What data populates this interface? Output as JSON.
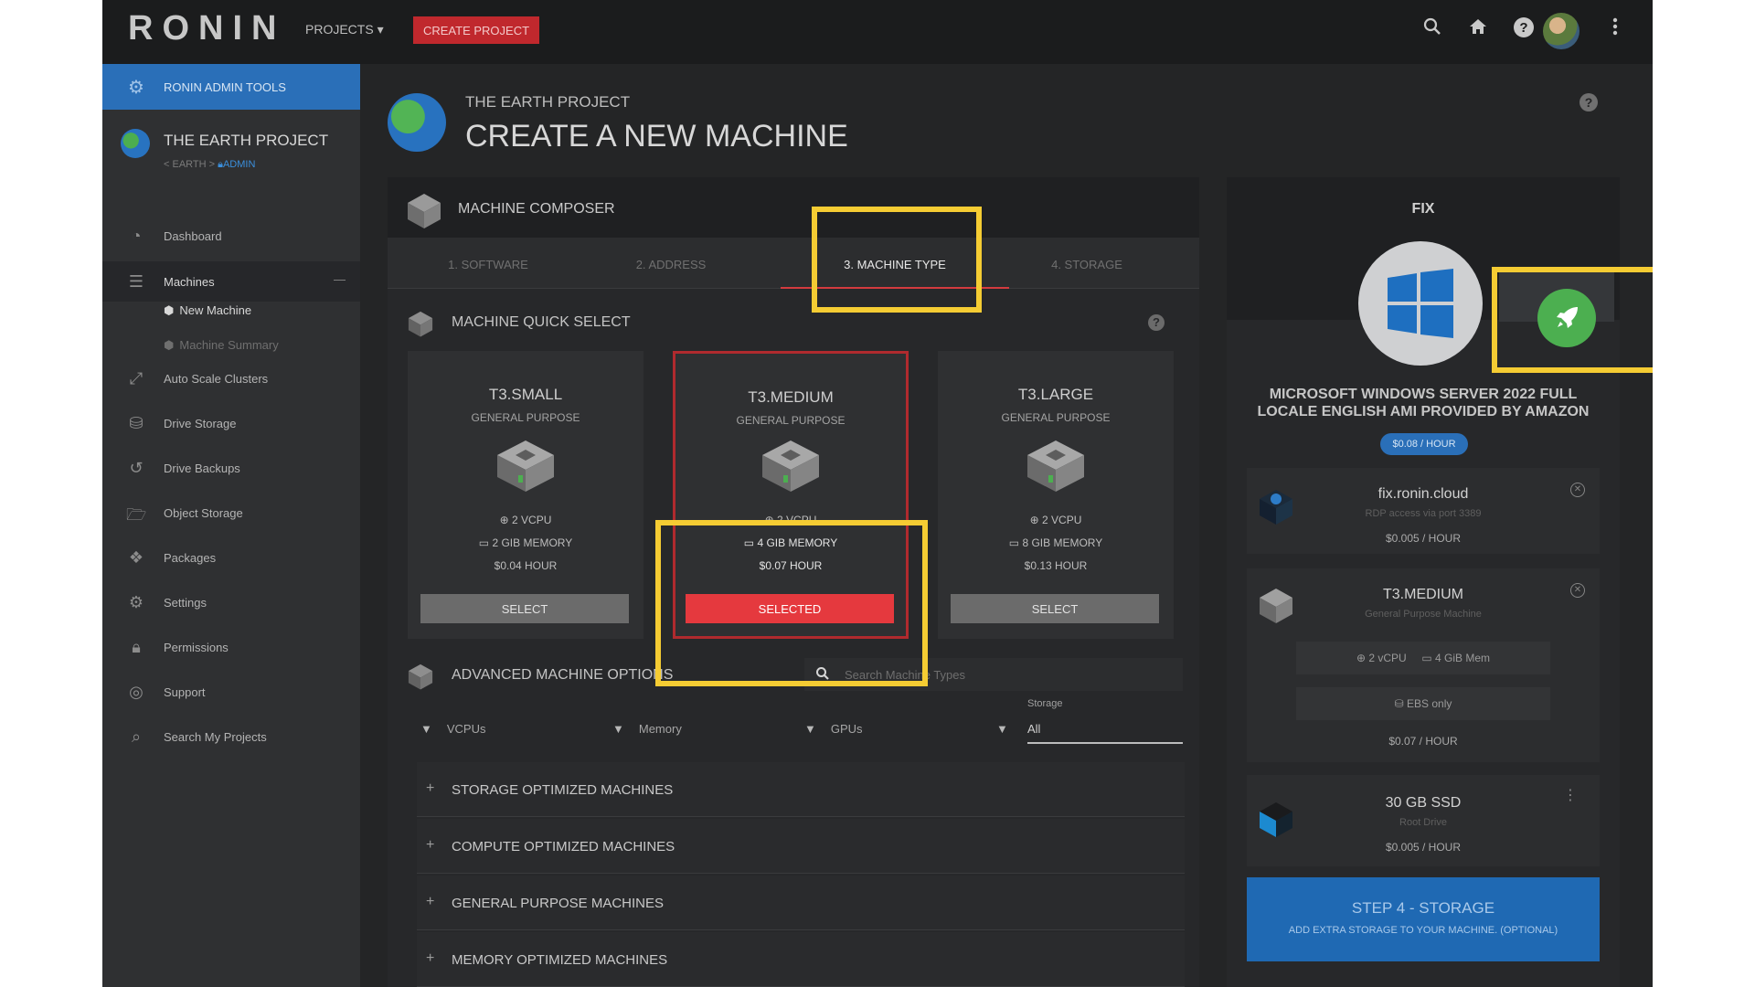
{
  "topbar": {
    "logo": "RONIN",
    "projects_label": "PROJECTS ▾",
    "create_project_label": "CREATE PROJECT",
    "icons": [
      "search-icon",
      "home-icon",
      "help-icon",
      "avatar",
      "kebab-icon"
    ]
  },
  "sidebar": {
    "admin_tools": "RONIN ADMIN TOOLS",
    "project_name": "THE EARTH PROJECT",
    "crumb": "< EARTH >",
    "crumb_admin": "ADMIN",
    "items": [
      {
        "label": "Dashboard",
        "icon": "dashboard-icon"
      },
      {
        "label": "Machines",
        "icon": "server-icon"
      },
      {
        "label": "Auto Scale Clusters",
        "icon": "expand-icon"
      },
      {
        "label": "Drive Storage",
        "icon": "drive-icon"
      },
      {
        "label": "Drive Backups",
        "icon": "history-icon"
      },
      {
        "label": "Object Storage",
        "icon": "folder-icon"
      },
      {
        "label": "Packages",
        "icon": "packages-icon"
      },
      {
        "label": "Settings",
        "icon": "gear-icon"
      },
      {
        "label": "Permissions",
        "icon": "lock-icon"
      },
      {
        "label": "Support",
        "icon": "lifebuoy-icon"
      },
      {
        "label": "Search My Projects",
        "icon": "search-icon"
      }
    ],
    "machines_collapse": "—",
    "sub_items": [
      {
        "label": "New Machine"
      },
      {
        "label": "Machine Summary"
      }
    ]
  },
  "header": {
    "subtitle": "THE EARTH PROJECT",
    "title": "CREATE A NEW MACHINE",
    "help": "?"
  },
  "composer": {
    "title": "MACHINE COMPOSER",
    "tabs": [
      "1. SOFTWARE",
      "2. ADDRESS",
      "3. MACHINE TYPE",
      "4. STORAGE"
    ],
    "active_tab": 2,
    "quick_select_title": "MACHINE QUICK SELECT",
    "help": "?",
    "machines": [
      {
        "name": "T3.SMALL",
        "kind": "GENERAL PURPOSE",
        "vcpu": "⊕ 2 VCPU",
        "memory": "▭ 2 GIB MEMORY",
        "price": "$0.04 HOUR",
        "button": "SELECT"
      },
      {
        "name": "T3.MEDIUM",
        "kind": "GENERAL PURPOSE",
        "vcpu": "⊕ 2 VCPU",
        "memory": "▭ 4 GIB MEMORY",
        "price": "$0.07 HOUR",
        "button": "SELECTED"
      },
      {
        "name": "T3.LARGE",
        "kind": "GENERAL PURPOSE",
        "vcpu": "⊕ 2 VCPU",
        "memory": "▭ 8 GIB MEMORY",
        "price": "$0.13 HOUR",
        "button": "SELECT"
      }
    ],
    "advanced_title": "ADVANCED MACHINE OPTIONS",
    "search_placeholder": "Search Machine Types",
    "filters": [
      "VCPUs",
      "Memory",
      "GPUs"
    ],
    "storage_label": "Storage",
    "storage_value": "All",
    "groups": [
      "STORAGE OPTIMIZED MACHINES",
      "COMPUTE OPTIMIZED MACHINES",
      "GENERAL PURPOSE MACHINES",
      "MEMORY OPTIMIZED MACHINES"
    ]
  },
  "summary": {
    "machine_name": "FIX",
    "os_name": "MICROSOFT WINDOWS SERVER 2022 FULL LOCALE ENGLISH AMI PROVIDED BY AMAZON",
    "os_price": "$0.08 / HOUR",
    "address": {
      "title": "fix.ronin.cloud",
      "sub": "RDP access via port 3389",
      "price": "$0.005 / HOUR"
    },
    "machine": {
      "title": "T3.MEDIUM",
      "sub": "General Purpose Machine",
      "vcpu": "⊕ 2 vCPU",
      "mem": "▭ 4 GiB Mem",
      "ebs": "⛁ EBS only",
      "price": "$0.07 / HOUR"
    },
    "storage": {
      "title": "30 GB SSD",
      "sub": "Root Drive",
      "price": "$0.005 / HOUR"
    },
    "step": {
      "title": "STEP 4 - STORAGE",
      "sub": "ADD EXTRA STORAGE TO YOUR MACHINE. (OPTIONAL)"
    }
  },
  "colors": {
    "accent_blue": "#2a6fb8",
    "accent_red": "#e5393e",
    "highlight": "#f5cc33",
    "launch_green": "#4caf50"
  }
}
